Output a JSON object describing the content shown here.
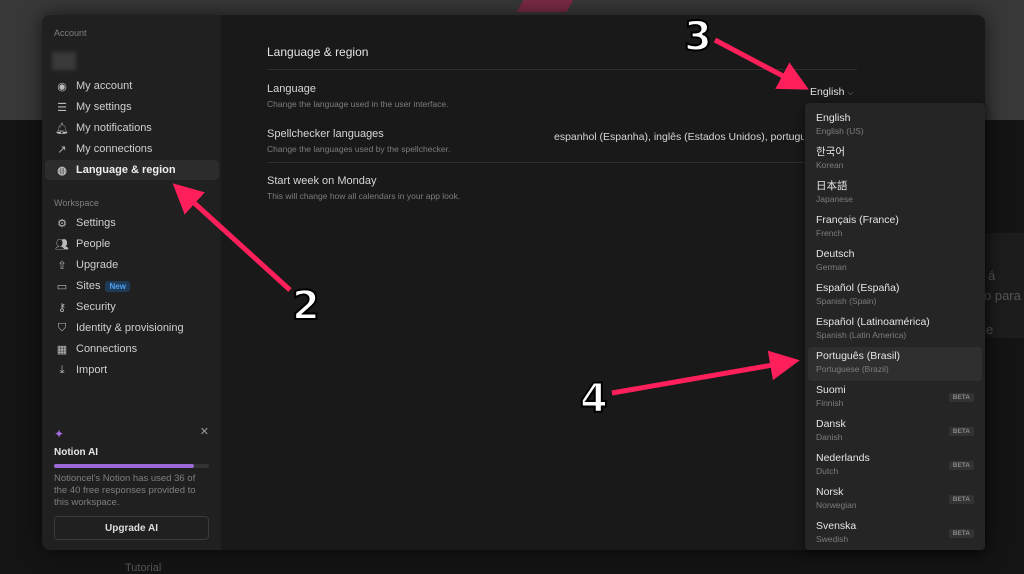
{
  "background": {
    "partial_text": [
      "á",
      "o para",
      "e"
    ],
    "tutorial": "Tutorial"
  },
  "sidebar": {
    "account_heading": "Account",
    "account_items": [
      {
        "label": "My account",
        "icon": "user-circle-icon"
      },
      {
        "label": "My settings",
        "icon": "sliders-icon"
      },
      {
        "label": "My notifications",
        "icon": "bell-icon"
      },
      {
        "label": "My connections",
        "icon": "external-link-icon"
      },
      {
        "label": "Language & region",
        "icon": "globe-icon",
        "active": true
      }
    ],
    "workspace_heading": "Workspace",
    "workspace_items": [
      {
        "label": "Settings",
        "icon": "gear-icon"
      },
      {
        "label": "People",
        "icon": "people-icon"
      },
      {
        "label": "Upgrade",
        "icon": "arrow-up-circle-icon"
      },
      {
        "label": "Sites",
        "icon": "browser-icon",
        "badge": "New"
      },
      {
        "label": "Security",
        "icon": "key-icon"
      },
      {
        "label": "Identity & provisioning",
        "icon": "shield-check-icon"
      },
      {
        "label": "Connections",
        "icon": "grid-icon"
      },
      {
        "label": "Import",
        "icon": "download-icon"
      }
    ],
    "ai_card": {
      "title": "Notion AI",
      "description": "Notioncel's Notion has used 36 of the 40 free responses provided to this workspace.",
      "used": 36,
      "total": 40,
      "button": "Upgrade AI",
      "accent": "#9b6ad6"
    }
  },
  "main": {
    "title": "Language & region",
    "language": {
      "label": "Language",
      "description": "Change the language used in the user interface.",
      "value": "English"
    },
    "spellchecker": {
      "label": "Spellchecker languages",
      "description": "Change the languages used by the spellchecker.",
      "value": "espanhol (Espanha), inglês (Estados Unidos), português"
    },
    "week": {
      "label": "Start week on Monday",
      "description": "This will change how all calendars in your app look."
    }
  },
  "dropdown": {
    "options": [
      {
        "name": "English",
        "english": "English (US)"
      },
      {
        "name": "한국어",
        "english": "Korean"
      },
      {
        "name": "日本語",
        "english": "Japanese"
      },
      {
        "name": "Français (France)",
        "english": "French"
      },
      {
        "name": "Deutsch",
        "english": "German"
      },
      {
        "name": "Español (España)",
        "english": "Spanish (Spain)"
      },
      {
        "name": "Español (Latinoamérica)",
        "english": "Spanish (Latin America)"
      },
      {
        "name": "Português (Brasil)",
        "english": "Portuguese (Brazil)",
        "highlighted": true
      },
      {
        "name": "Suomi",
        "english": "Finnish",
        "badge": "BETA"
      },
      {
        "name": "Dansk",
        "english": "Danish",
        "badge": "BETA"
      },
      {
        "name": "Nederlands",
        "english": "Dutch",
        "badge": "BETA"
      },
      {
        "name": "Norsk",
        "english": "Norwegian",
        "badge": "BETA"
      },
      {
        "name": "Svenska",
        "english": "Swedish",
        "badge": "BETA"
      }
    ]
  },
  "annotations": {
    "step2": "2",
    "step3": "3",
    "step4": "4",
    "color": "#ff1f5a"
  }
}
